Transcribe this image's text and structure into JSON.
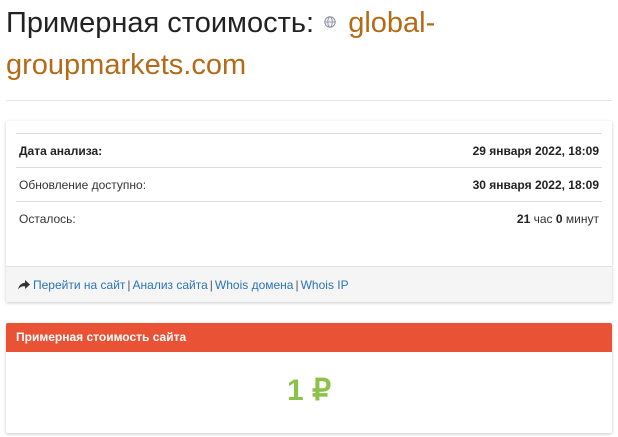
{
  "header": {
    "title_prefix": "Примерная стоимость:",
    "domain": "global-groupmarkets.com"
  },
  "info": {
    "rows": [
      {
        "label": "Дата анализа:",
        "value": "29 января 2022, 18:09"
      },
      {
        "label": "Обновление доступно:",
        "value": "30 января 2022, 18:09"
      },
      {
        "label": "Осталось:",
        "hours": "21",
        "hours_unit": "час",
        "minutes": "0",
        "minutes_unit": "минут"
      }
    ]
  },
  "footer_links": {
    "goto_site": "Перейти на сайт",
    "analysis": "Анализ сайта",
    "whois_domain": "Whois домена",
    "whois_ip": "Whois IP",
    "separator": "|"
  },
  "estimate": {
    "header": "Примерная стоимость сайта",
    "amount": "1 ₽"
  },
  "colors": {
    "domain_link": "#b46a16",
    "links": "#2a74b8",
    "estimate_header_bg": "#e95235",
    "estimate_amount": "#8bc34a"
  },
  "icons": {
    "title": "globe-icon",
    "footer": "share-arrow-icon"
  }
}
